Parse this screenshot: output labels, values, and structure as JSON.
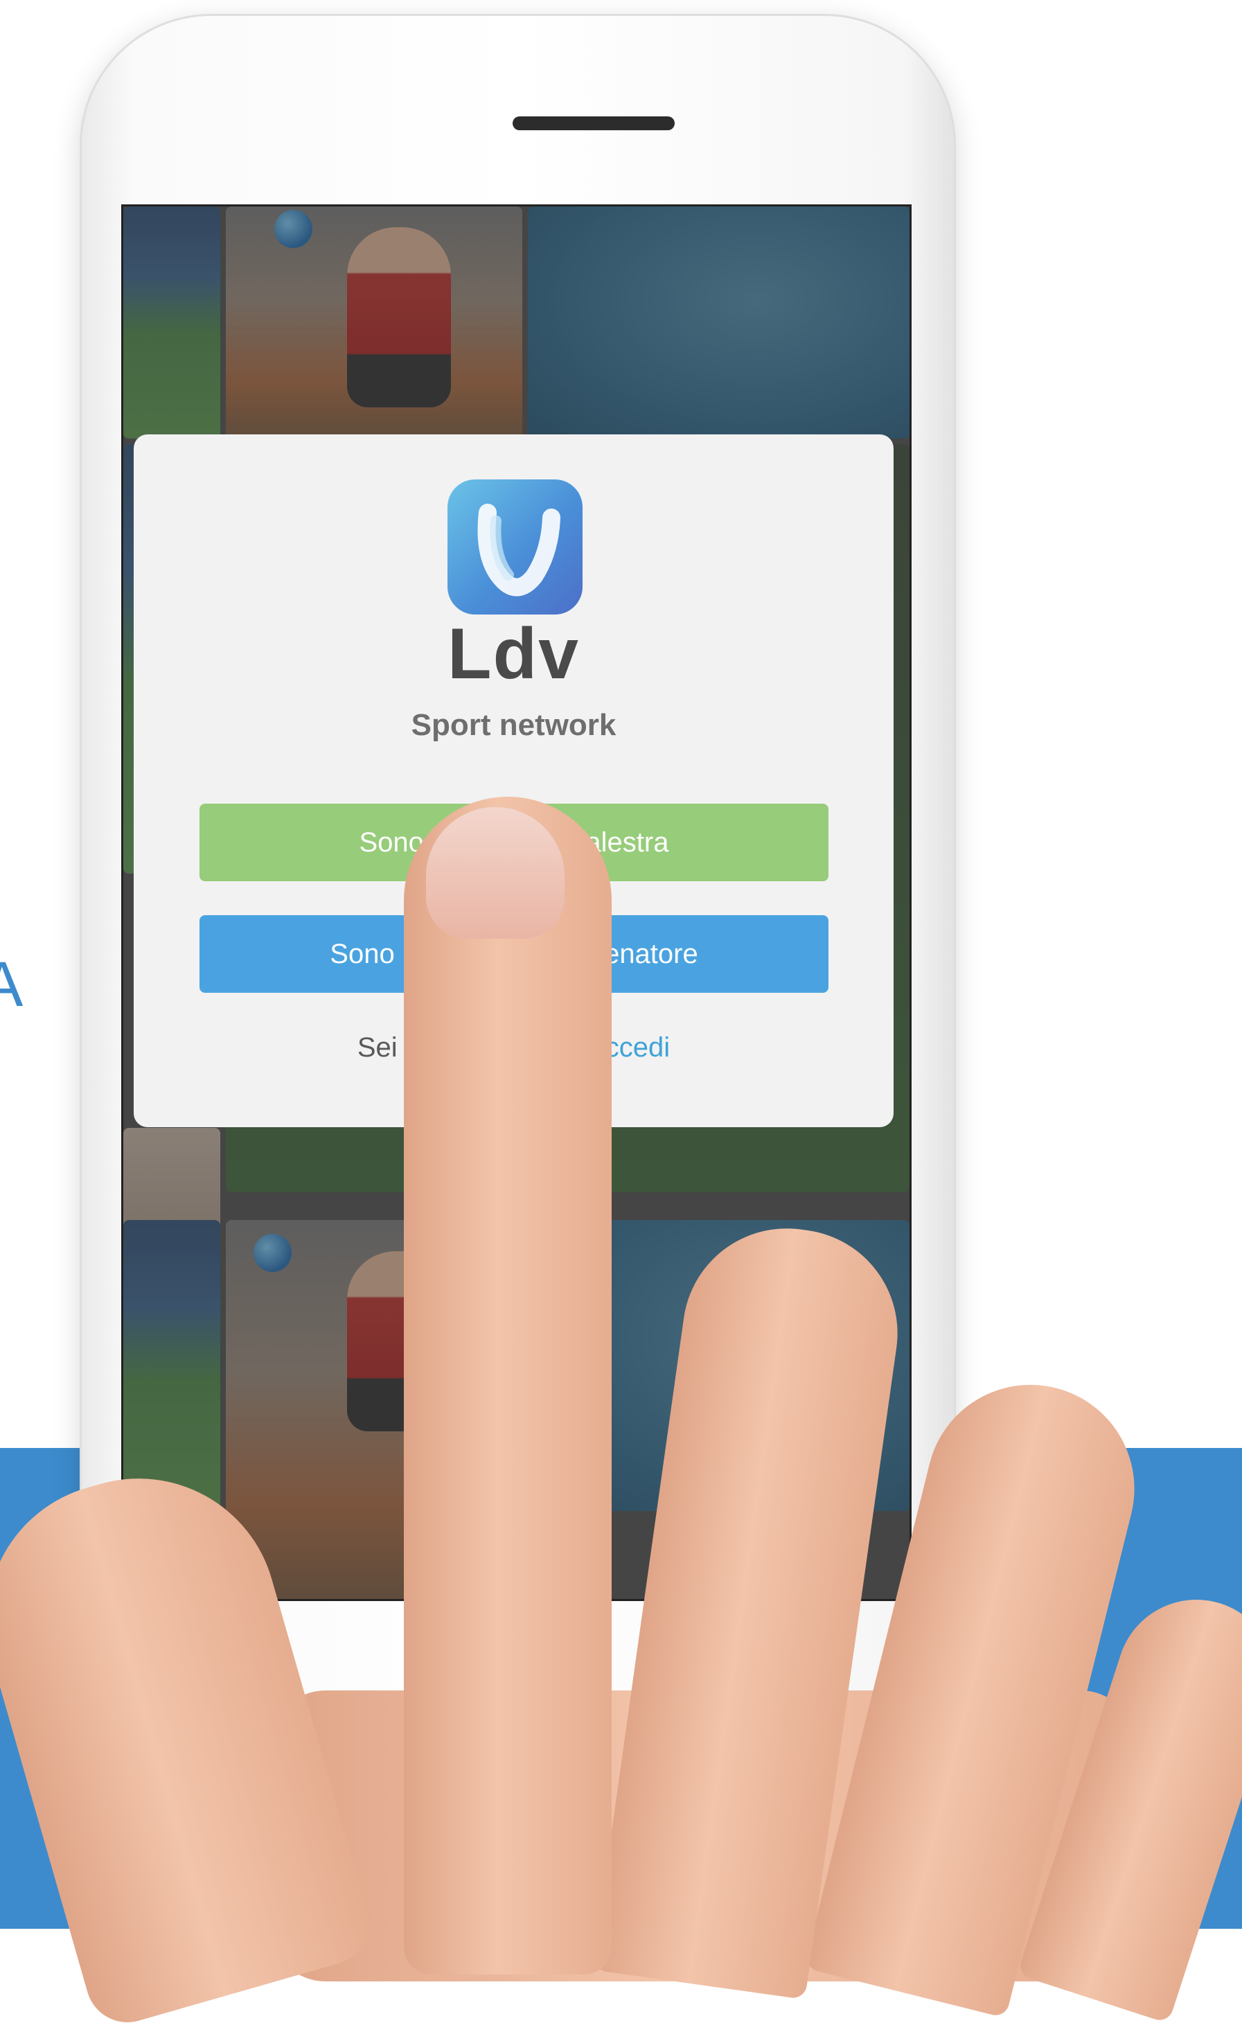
{
  "side_text": "A",
  "app": {
    "brand_name": "Ldv",
    "tagline": "Sport network"
  },
  "buttons": {
    "gym_label": "Sono un gestore palestra",
    "athlete_label": "Sono uno sportivo / allenatore"
  },
  "login": {
    "prompt": "Sei già registrato?",
    "link": "Accedi"
  },
  "colors": {
    "band": "#3d8bcc",
    "green_button": "#97cc7a",
    "blue_button": "#4aa3e0",
    "link": "#3fa3d8"
  }
}
